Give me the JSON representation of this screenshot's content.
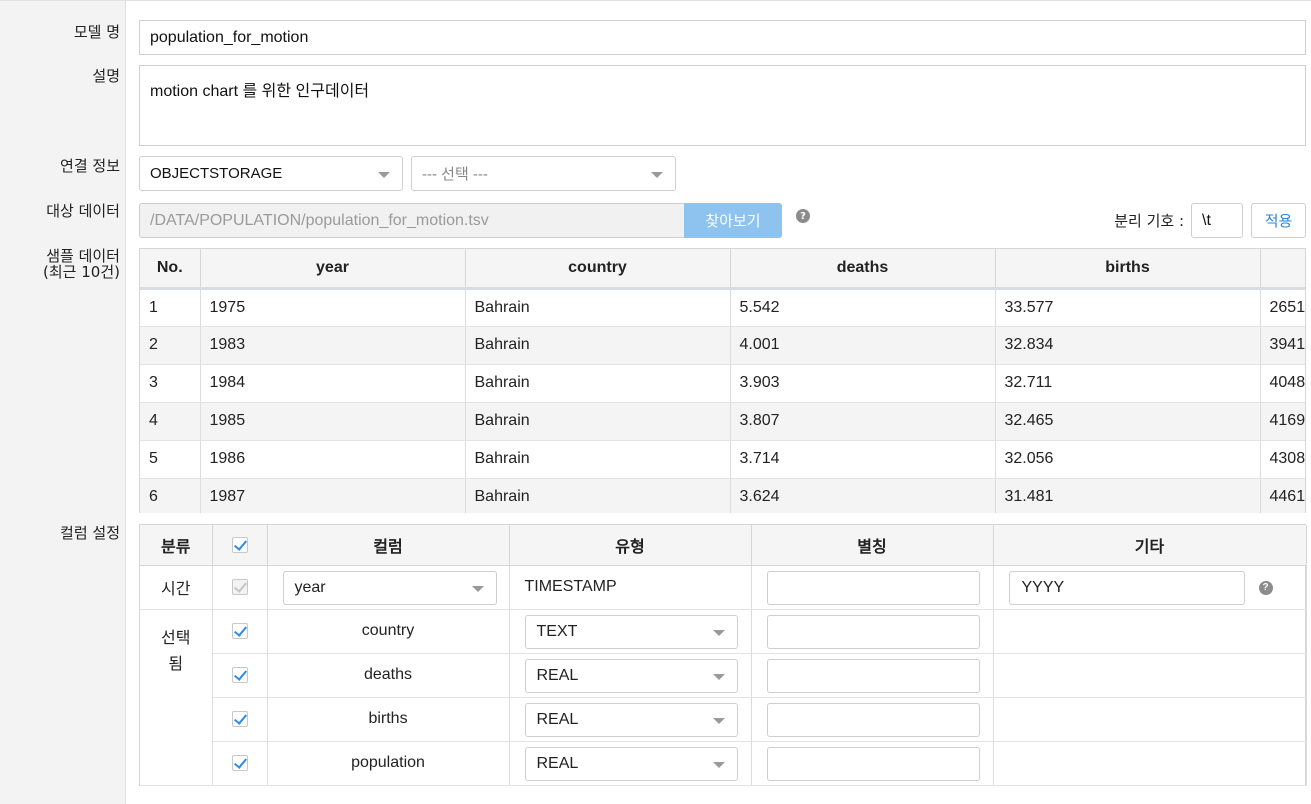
{
  "labels": {
    "model_name": "모델 명",
    "description": "설명",
    "connection": "연결 정보",
    "target_data": "대상 데이터",
    "sample_data_line1": "샘플 데이터",
    "sample_data_line2": "(최근 10건)",
    "column_settings": "컬럼 설정"
  },
  "model_name_value": "population_for_motion",
  "description_value": "motion chart  를 위한 인구데이터",
  "connection": {
    "type_selected": "OBJECTSTORAGE",
    "sub_selected": "--- 선택 ---"
  },
  "target": {
    "path": "/DATA/POPULATION/population_for_motion.tsv",
    "browse_label": "찾아보기",
    "separator_label": "분리 기호 :",
    "separator_value": "\\t",
    "apply_label": "적용"
  },
  "sample_table": {
    "headers": [
      "No.",
      "year",
      "country",
      "deaths",
      "births",
      ""
    ],
    "rows": [
      [
        "1",
        "1975",
        "Bahrain",
        "5.542",
        "33.577",
        "2651"
      ],
      [
        "2",
        "1983",
        "Bahrain",
        "4.001",
        "32.834",
        "3941"
      ],
      [
        "3",
        "1984",
        "Bahrain",
        "3.903",
        "32.711",
        "4048"
      ],
      [
        "4",
        "1985",
        "Bahrain",
        "3.807",
        "32.465",
        "4169"
      ],
      [
        "5",
        "1986",
        "Bahrain",
        "3.714",
        "32.056",
        "4308"
      ],
      [
        "6",
        "1987",
        "Bahrain",
        "3.624",
        "31.481",
        "4461"
      ]
    ]
  },
  "column_table": {
    "headers": {
      "category": "분류",
      "column": "컬럼",
      "type": "유형",
      "alias": "별칭",
      "etc": "기타"
    },
    "time_row": {
      "category": "시간",
      "column": "year",
      "type": "TIMESTAMP",
      "etc": "YYYY"
    },
    "selected_category": "선택 됨",
    "selected_rows": [
      {
        "column": "country",
        "type": "TEXT"
      },
      {
        "column": "deaths",
        "type": "REAL"
      },
      {
        "column": "births",
        "type": "REAL"
      },
      {
        "column": "population",
        "type": "REAL"
      }
    ]
  },
  "colors": {
    "accent": "#2f8be6",
    "browse_button": "#8ec3ef",
    "label_column_bg": "#f3f3f3"
  }
}
